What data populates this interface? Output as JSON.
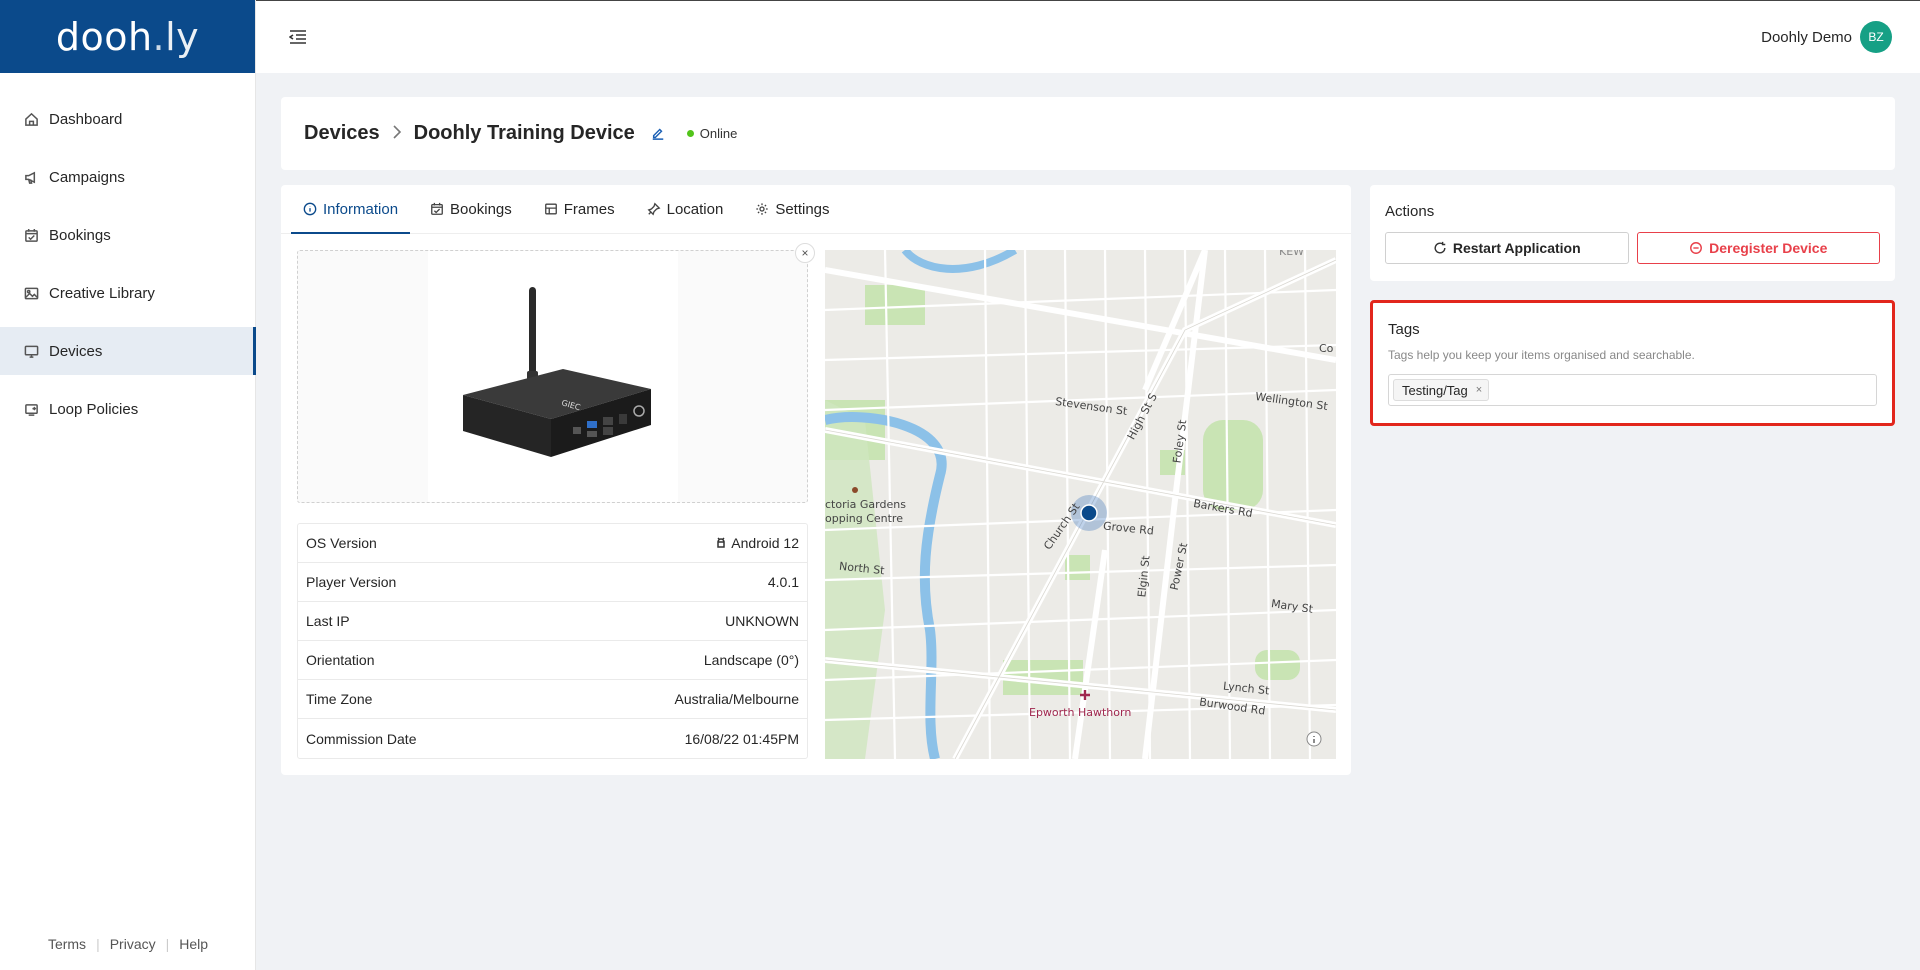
{
  "brand": {
    "logo_main": "dooh",
    "logo_dot": ".",
    "logo_suffix": "ly"
  },
  "sidebar": {
    "items": [
      {
        "label": "Dashboard",
        "icon": "home-icon"
      },
      {
        "label": "Campaigns",
        "icon": "megaphone-icon"
      },
      {
        "label": "Bookings",
        "icon": "calendar-icon"
      },
      {
        "label": "Creative Library",
        "icon": "image-icon"
      },
      {
        "label": "Devices",
        "icon": "monitor-icon",
        "active": true
      },
      {
        "label": "Loop Policies",
        "icon": "loop-icon"
      }
    ],
    "footer": {
      "terms": "Terms",
      "privacy": "Privacy",
      "help": "Help"
    }
  },
  "topbar": {
    "user_name": "Doohly Demo",
    "avatar_initials": "BZ"
  },
  "header": {
    "breadcrumb_root": "Devices",
    "title": "Doohly Training Device",
    "status": "Online",
    "status_color": "#52c41a"
  },
  "tabs": [
    {
      "label": "Information",
      "icon": "info-icon",
      "active": true
    },
    {
      "label": "Bookings",
      "icon": "calendar-icon"
    },
    {
      "label": "Frames",
      "icon": "frame-icon"
    },
    {
      "label": "Location",
      "icon": "pin-icon"
    },
    {
      "label": "Settings",
      "icon": "gear-icon"
    }
  ],
  "image": {
    "close_label": "×"
  },
  "info": [
    {
      "label": "OS Version",
      "value": "Android 12",
      "icon": "android-icon"
    },
    {
      "label": "Player Version",
      "value": "4.0.1"
    },
    {
      "label": "Last IP",
      "value": "UNKNOWN"
    },
    {
      "label": "Orientation",
      "value": "Landscape (0°)"
    },
    {
      "label": "Time Zone",
      "value": "Australia/Melbourne"
    },
    {
      "label": "Commission Date",
      "value": "16/08/22 01:45PM"
    }
  ],
  "map": {
    "labels": {
      "stevenson": "Stevenson St",
      "high": "High St S",
      "foley": "Foley St",
      "wellington": "Wellington St",
      "barkers": "Barkers Rd",
      "gardens1": "ctoria Gardens",
      "gardens2": "opping Centre",
      "church": "Church St",
      "grove": "Grove Rd",
      "north": "North St",
      "elgin": "Elgin St",
      "power": "Power St",
      "mary": "Mary St",
      "lynch": "Lynch St",
      "burwood": "Burwood Rd",
      "epworth": "Epworth Hawthorn",
      "kew": "KEW",
      "co": "Co"
    }
  },
  "actions": {
    "title": "Actions",
    "restart": "Restart Application",
    "deregister": "Deregister Device",
    "danger_color": "#e8404a"
  },
  "tags": {
    "title": "Tags",
    "help": "Tags help you keep your items organised and searchable.",
    "items": [
      "Testing/Tag"
    ],
    "remove_label": "×"
  }
}
